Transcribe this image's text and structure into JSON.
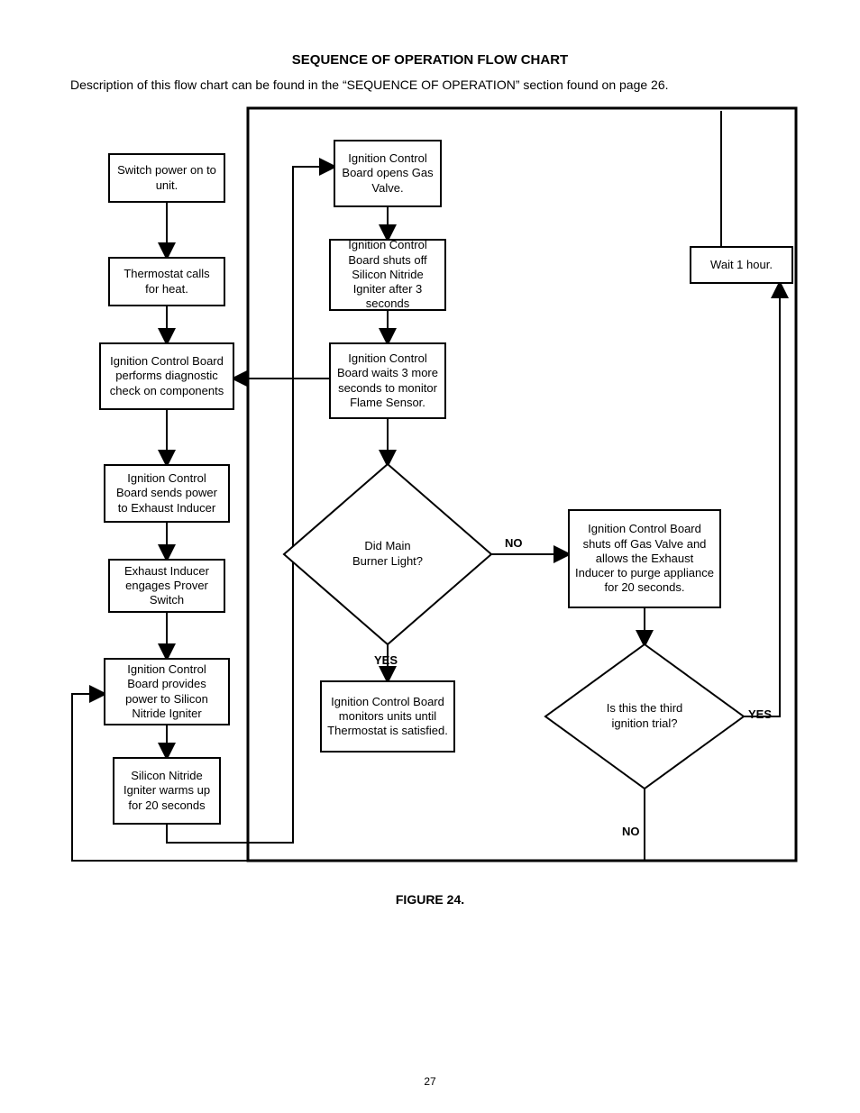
{
  "title": "SEQUENCE OF OPERATION FLOW CHART",
  "description": "Description of this flow chart can be found in the “SEQUENCE OF OPERATION” section found on page 26.",
  "figure_caption": "FIGURE 24.",
  "page_number": "27",
  "nodes": {
    "a1": "Switch power on to unit.",
    "a2": "Thermostat calls for heat.",
    "a3": "Ignition Control Board performs diagnostic check on components",
    "a4": "Ignition Control Board sends power to Exhaust Inducer",
    "a5": "Exhaust Inducer engages Prover Switch",
    "a6": "Ignition Control Board provides power to Silicon Nitride Igniter",
    "a7": "Silicon Nitride Igniter warms up for 20 seconds",
    "b1": "Ignition Control Board opens Gas Valve.",
    "b2": "Ignition Control Board shuts off Silicon Nitride Igniter after 3 seconds",
    "b3": "Ignition Control Board waits 3 more seconds to monitor Flame Sensor.",
    "b5": "Ignition Control Board monitors units until Thermostat is satisfied.",
    "c1": "Wait 1 hour.",
    "c2": "Ignition Control Board shuts off Gas Valve and allows the Exhaust Inducer to purge appliance for 20 seconds.",
    "d1_l1": "Did Main",
    "d1_l2": "Burner Light?",
    "d2_l1": "Is this the third",
    "d2_l2": "ignition trial?"
  },
  "labels": {
    "yes": "YES",
    "no": "NO"
  }
}
